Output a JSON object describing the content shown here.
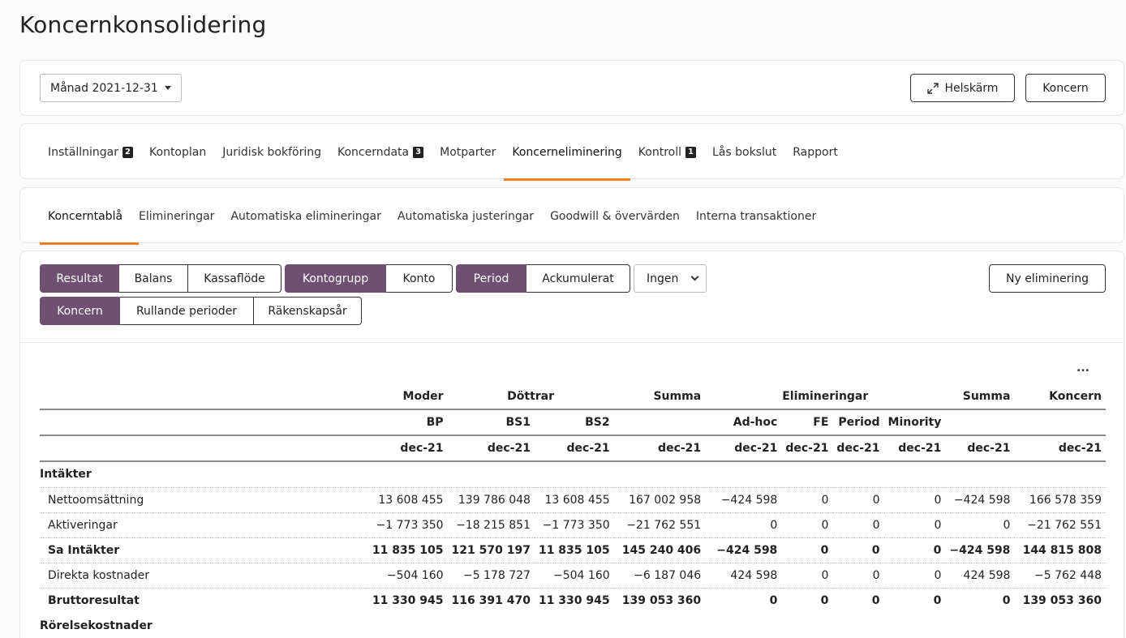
{
  "page": {
    "title": "Koncernkonsolidering"
  },
  "topbar": {
    "period_select": "Månad 2021-12-31",
    "fullscreen_label": "Helskärm",
    "koncern_label": "Koncern"
  },
  "main_tabs": [
    {
      "label": "Inställningar",
      "badge": "2"
    },
    {
      "label": "Kontoplan",
      "badge": ""
    },
    {
      "label": "Juridisk bokföring",
      "badge": ""
    },
    {
      "label": "Koncerndata",
      "badge": "3"
    },
    {
      "label": "Motparter",
      "badge": ""
    },
    {
      "label": "Koncerneliminering",
      "badge": "",
      "active": true
    },
    {
      "label": "Kontroll",
      "badge": "1"
    },
    {
      "label": "Lås bokslut",
      "badge": ""
    },
    {
      "label": "Rapport",
      "badge": ""
    }
  ],
  "sub_tabs": [
    {
      "label": "Koncerntablå",
      "active": true
    },
    {
      "label": "Elimineringar"
    },
    {
      "label": "Automatiska elimineringar"
    },
    {
      "label": "Automatiska justeringar"
    },
    {
      "label": "Goodwill & övervärden"
    },
    {
      "label": "Interna transaktioner"
    }
  ],
  "toolbar": {
    "report_type": [
      "Resultat",
      "Balans",
      "Kassaflöde"
    ],
    "grouping": [
      "Kontogrupp",
      "Konto"
    ],
    "period_mode": [
      "Period",
      "Ackumulerat"
    ],
    "dropdown_value": "Ingen",
    "scope": [
      "Koncern",
      "Rullande perioder",
      "Räkenskapsår"
    ],
    "new_elimination_label": "Ny eliminering",
    "more_label": "..."
  },
  "colors": {
    "accent": "#6f4f72",
    "tab_underline": "#f07c26"
  },
  "table": {
    "header1": [
      "",
      "Moder",
      "Döttrar",
      "",
      "Summa",
      "Elimineringar",
      "",
      "",
      "",
      "Summa",
      "Koncern"
    ],
    "header2": [
      "",
      "BP",
      "BS1",
      "BS2",
      "",
      "Ad-hoc",
      "FE",
      "Period",
      "Minority",
      "",
      ""
    ],
    "header3": [
      "",
      "dec-21",
      "dec-21",
      "dec-21",
      "dec-21",
      "dec-21",
      "dec-21",
      "dec-21",
      "dec-21",
      "dec-21",
      "dec-21"
    ],
    "sections": [
      {
        "title": "Intäkter",
        "rows": [
          {
            "label": "Nettoomsättning",
            "bold": false,
            "values": [
              "13 608 455",
              "139 786 048",
              "13 608 455",
              "167 002 958",
              "−424 598",
              "0",
              "0",
              "0",
              "−424 598",
              "166 578 359"
            ]
          },
          {
            "label": "Aktiveringar",
            "bold": false,
            "values": [
              "−1 773 350",
              "−18 215 851",
              "−1 773 350",
              "−21 762 551",
              "0",
              "0",
              "0",
              "0",
              "0",
              "−21 762 551"
            ]
          },
          {
            "label": "Sa Intäkter",
            "bold": true,
            "values": [
              "11 835 105",
              "121 570 197",
              "11 835 105",
              "145 240 406",
              "−424 598",
              "0",
              "0",
              "0",
              "−424 598",
              "144 815 808"
            ]
          },
          {
            "label": "Direkta kostnader",
            "bold": false,
            "values": [
              "−504 160",
              "−5 178 727",
              "−504 160",
              "−6 187 046",
              "424 598",
              "0",
              "0",
              "0",
              "424 598",
              "−5 762 448"
            ]
          },
          {
            "label": "Bruttoresultat",
            "bold": true,
            "values": [
              "11 330 945",
              "116 391 470",
              "11 330 945",
              "139 053 360",
              "0",
              "0",
              "0",
              "0",
              "0",
              "139 053 360"
            ]
          }
        ]
      },
      {
        "title": "Rörelsekostnader",
        "rows": []
      }
    ]
  }
}
